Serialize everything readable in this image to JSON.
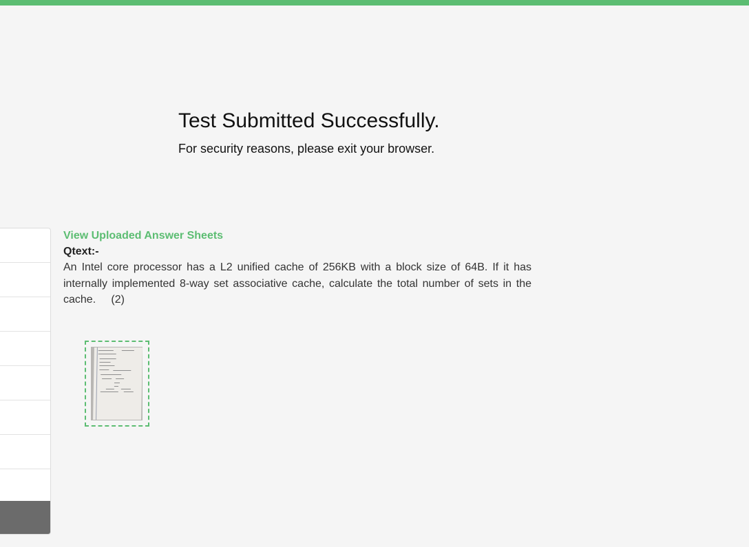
{
  "colors": {
    "accent": "#5cbd72",
    "background": "#f5f5f5",
    "sidebar_footer": "#6b6b6b"
  },
  "status": {
    "title": "Test Submitted Successfully.",
    "subtitle": "For security reasons, please exit your browser."
  },
  "answer_sheets": {
    "link_label": "View Uploaded Answer Sheets",
    "qtext_label": "Qtext:-",
    "question_text": "An Intel core processor has a L2 unified cache of 256KB with a block size of 64B. If it has internally implemented 8-way set associative cache, calculate the total number of sets in the cache.     (2)",
    "thumbnail_icon": "answer-sheet-thumbnail"
  },
  "sidebar": {
    "row_count": 8
  }
}
